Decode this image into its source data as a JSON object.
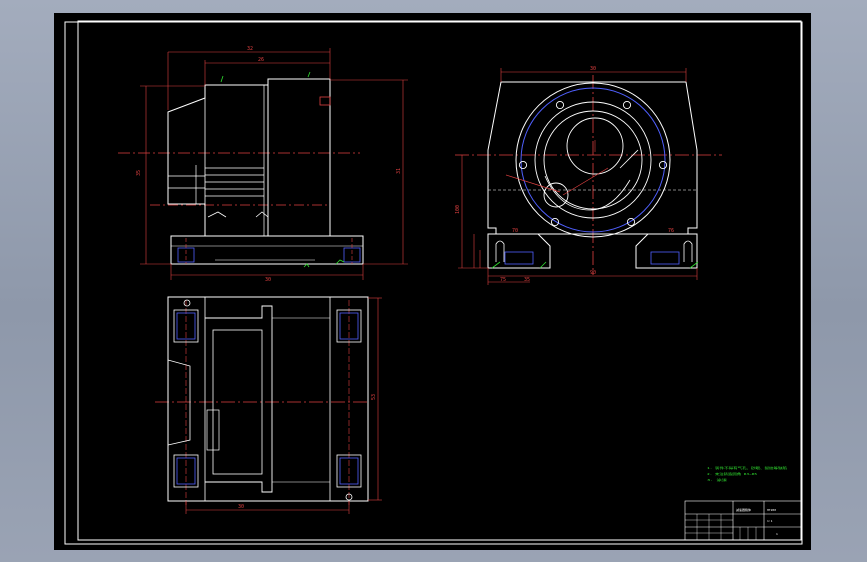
{
  "drawing": {
    "side_view": {
      "dims_top": [
        "32",
        "26"
      ],
      "dim_left": "35",
      "dim_right": "31",
      "dim_bottom": "30"
    },
    "front_view": {
      "dim_top": "30",
      "dim_left": "100",
      "dims_foot_left": [
        "70",
        "76"
      ],
      "dims_bottom": [
        "90",
        "75",
        "35"
      ]
    },
    "plan_view": {
      "dim_right": "53",
      "dim_bottom": "30"
    },
    "notes": {
      "line1": "1. 铸件不得有气孔、砂眼、裂纹等缺陷",
      "line2": "2. 未注铸造圆角 R3~R5",
      "line3": "3. 涂漆"
    },
    "title_block": {
      "part_name": "减速器箱体",
      "material": "HT200",
      "scale": "1:1",
      "sheet": "1"
    }
  }
}
